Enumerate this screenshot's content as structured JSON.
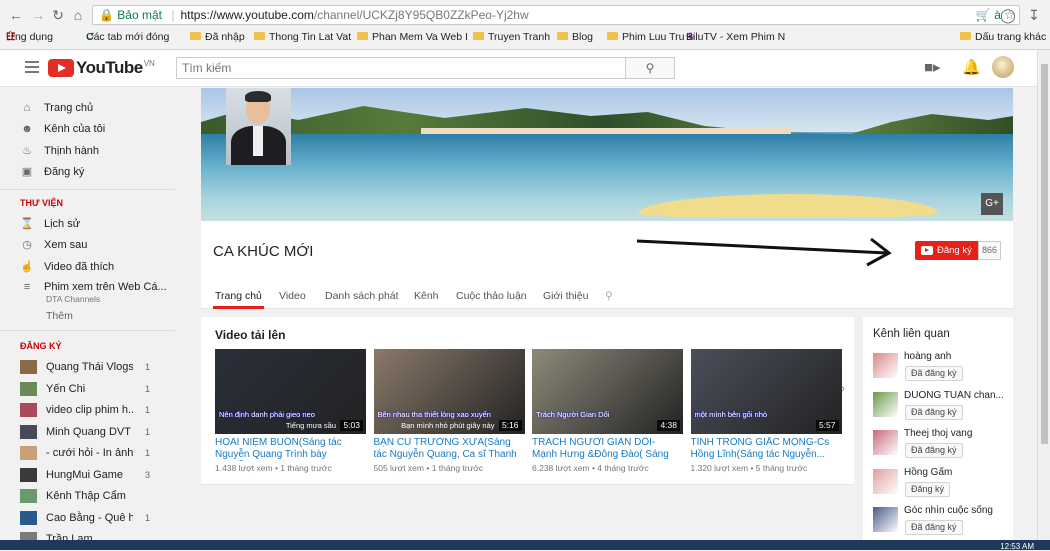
{
  "browser": {
    "secure_label": "Bảo mật",
    "url_base": "https://www.youtube.com",
    "url_path": "/channel/UCKZj8Y95QB0ZZkPeo-Yj2hw",
    "bookmarks": [
      {
        "label": "Ứng dụng"
      },
      {
        "label": "Các tab mới đóng"
      },
      {
        "label": "Đã nhập"
      },
      {
        "label": "Thong Tin Lat Vat"
      },
      {
        "label": "Phan Mem Va Web I"
      },
      {
        "label": "Truyen Tranh"
      },
      {
        "label": "Blog"
      },
      {
        "label": "Phim Luu Tru"
      },
      {
        "label": "BiluTV - Xem Phim N"
      },
      {
        "label": "Dấu trang khác"
      }
    ]
  },
  "header": {
    "logo_text": "YouTube",
    "logo_region": "VN",
    "search_placeholder": "Tìm kiếm"
  },
  "sidebar": {
    "main_items": [
      "Trang chủ",
      "Kênh của tôi",
      "Thịnh hành",
      "Đăng ký"
    ],
    "library_heading": "THƯ VIỆN",
    "library_items": [
      "Lịch sử",
      "Xem sau",
      "Video đã thích"
    ],
    "playlist": {
      "title": "Phim xem trên Web Cá...",
      "owner": "DTA Channels"
    },
    "more_label": "Thêm",
    "subs_heading": "ĐĂNG KÝ",
    "subscriptions": [
      {
        "name": "Quang Thái Vlogs",
        "count": "1",
        "color": "#8a6a4a"
      },
      {
        "name": "Yến Chi",
        "count": "1",
        "color": "#6a8a5a"
      },
      {
        "name": "video clip phim h...",
        "count": "1",
        "color": "#aa4a5a"
      },
      {
        "name": "Minh Quang DVT",
        "count": "1",
        "color": "#4a4a5a"
      },
      {
        "name": "- cưới hỏi - In ảnh...",
        "count": "1",
        "color": "#c9a07a"
      },
      {
        "name": "HungMui Game",
        "count": "3",
        "color": "#3a3a3a"
      },
      {
        "name": "Kênh Thập Cẩm",
        "count": "",
        "color": "#6a9a6a"
      },
      {
        "name": "Cao Bằng - Quê h...",
        "count": "1",
        "color": "#2a5a8a"
      },
      {
        "name": "Trần Lam",
        "count": "",
        "color": "#7a7a7a"
      }
    ]
  },
  "channel": {
    "name": "CA KHÚC MỚI",
    "subscribe_label": "Đăng ký",
    "subscriber_count": "866",
    "tabs": [
      "Trang chủ",
      "Video",
      "Danh sách phát",
      "Kênh",
      "Cuộc thảo luận",
      "Giới thiệu"
    ]
  },
  "uploads": {
    "title": "Video tải lên",
    "videos": [
      {
        "title": "HOÀI NIỆM BUỒN(Sáng tác Nguyễn Quang Trình bày Nguyễ...",
        "views": "1.438 lượt xem",
        "age": "1 tháng trước",
        "duration": "5:03",
        "bg": "#2a2f3a",
        "caption": "Nên định danh phải gieo neo",
        "caption2": "Tiếng mưa sầu"
      },
      {
        "title": "BẠN CŨ TRƯỜNG XƯA(Sáng tác Nguyễn Quang, Ca sĩ Thanh Vũ)",
        "views": "505 lượt xem",
        "age": "1 tháng trước",
        "duration": "5:16",
        "bg": "#8a7a6a",
        "caption": "Bên nhau tha thiết lòng xao xuyến",
        "caption2": "Bạn mình nhỏ phút giây này"
      },
      {
        "title": "TRÁCH NGƯỜI GIAN DỐI- Mạnh Hưng &Đông Đào( Sáng tác...",
        "views": "6.238 lượt xem",
        "age": "4 tháng trước",
        "duration": "4:38",
        "bg": "#8e8a7a",
        "caption": "Trách Người Gian Dối",
        "caption2": ""
      },
      {
        "title": "TÌNH TRONG GIẤC MỘNG-Cs Hồng Lĩnh(Sáng tác Nguyễn...",
        "views": "1.320 lượt xem",
        "age": "5 tháng trước",
        "duration": "5:57",
        "bg": "#4a4f5a",
        "caption": "một mình bên gối nhỏ",
        "caption2": ""
      }
    ]
  },
  "related": {
    "title": "Kênh liên quan",
    "button_label": "Đã đăng ký",
    "channels": [
      {
        "name": "hoàng anh",
        "button": "Đã đăng ký",
        "color": "#d88a8a"
      },
      {
        "name": "DUONG TUAN chan...",
        "button": "Đã đăng ký",
        "color": "#6a9a4a"
      },
      {
        "name": "Theej thoj vang",
        "button": "Đã đăng ký",
        "color": "#c86a7a"
      },
      {
        "name": "Hồng Gấm",
        "button": "Đăng ký",
        "color": "#e0a0a0"
      },
      {
        "name": "Góc nhìn cuộc sống",
        "button": "Đã đăng ký",
        "color": "#4a5a8a"
      }
    ]
  },
  "taskbar": {
    "clock": "12:53 AM"
  }
}
